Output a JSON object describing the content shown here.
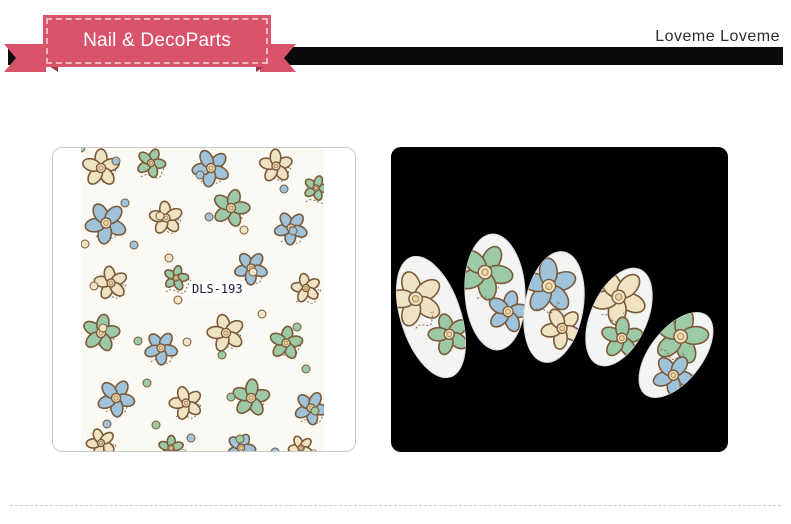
{
  "header": {
    "brand_label": "Nail & DecoParts",
    "store_name": "Loveme Loveme"
  },
  "left_panel": {
    "code_label": "DLS-193"
  },
  "colors": {
    "ribbon": "#d9546a",
    "ribbon_dark": "#b23f53",
    "bar": "#0b0b0b",
    "flower_green": "#9cc9a6",
    "flower_blue": "#9fc3db",
    "flower_brown": "#7a5a3a",
    "flower_cream": "#efe3c4"
  }
}
